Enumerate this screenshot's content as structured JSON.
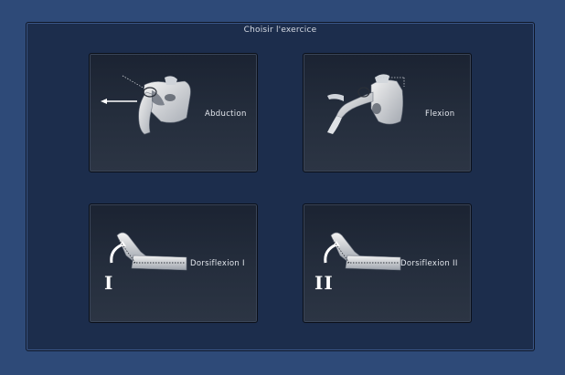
{
  "panel": {
    "title": "Choisir l'exercice"
  },
  "exercises": [
    {
      "label": "Abduction",
      "illustration": "shoulder-abduction-icon"
    },
    {
      "label": "Flexion",
      "illustration": "shoulder-flexion-icon"
    },
    {
      "label": "Dorsiflexion I",
      "illustration": "ankle-dorsiflexion-icon",
      "numeral": "I"
    },
    {
      "label": "Dorsiflexion II",
      "illustration": "ankle-dorsiflexion-icon",
      "numeral": "II"
    }
  ],
  "colors": {
    "background": "#2e4a78",
    "panel": "#1c2d4c",
    "card": "#242d3c",
    "text": "#e4e8ee"
  }
}
